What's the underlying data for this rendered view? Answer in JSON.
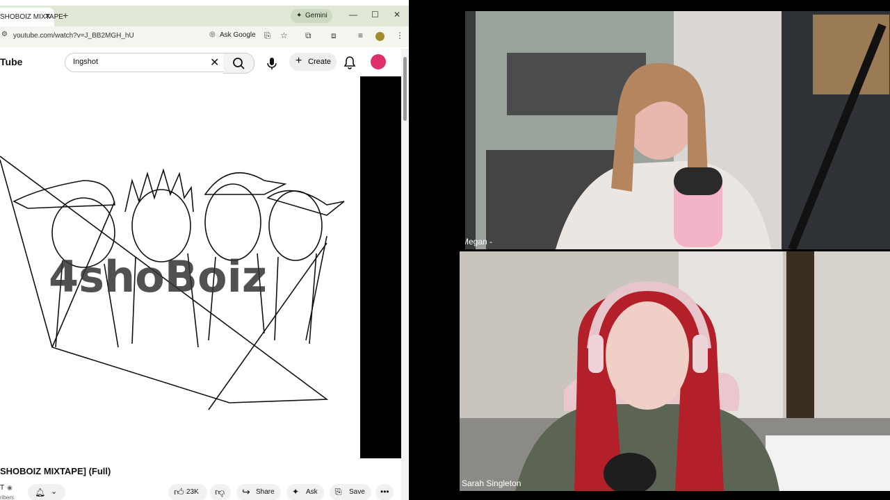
{
  "browser": {
    "tab_title": "SHOBOIZ MIXTAPE",
    "gemini_label": "Gemini",
    "url": "youtube.com/watch?v=J_BB2MGH_hU",
    "ask_google_label": "Ask Google"
  },
  "youtube": {
    "logo_text": "Tube",
    "search_query": "Ingshot",
    "create_label": "Create",
    "video_title": "SHOBOIZ MIXTAPE] (Full)",
    "channel_name": "T",
    "subscribers_fragment": "ribers",
    "like_count": "23K",
    "share_label": "Share",
    "ask_label": "Ask",
    "save_label": "Save",
    "thumbnail_text": "4shoBoiz"
  },
  "call": {
    "participant_1": "Megan -",
    "participant_2": "Sarah Singleton"
  }
}
